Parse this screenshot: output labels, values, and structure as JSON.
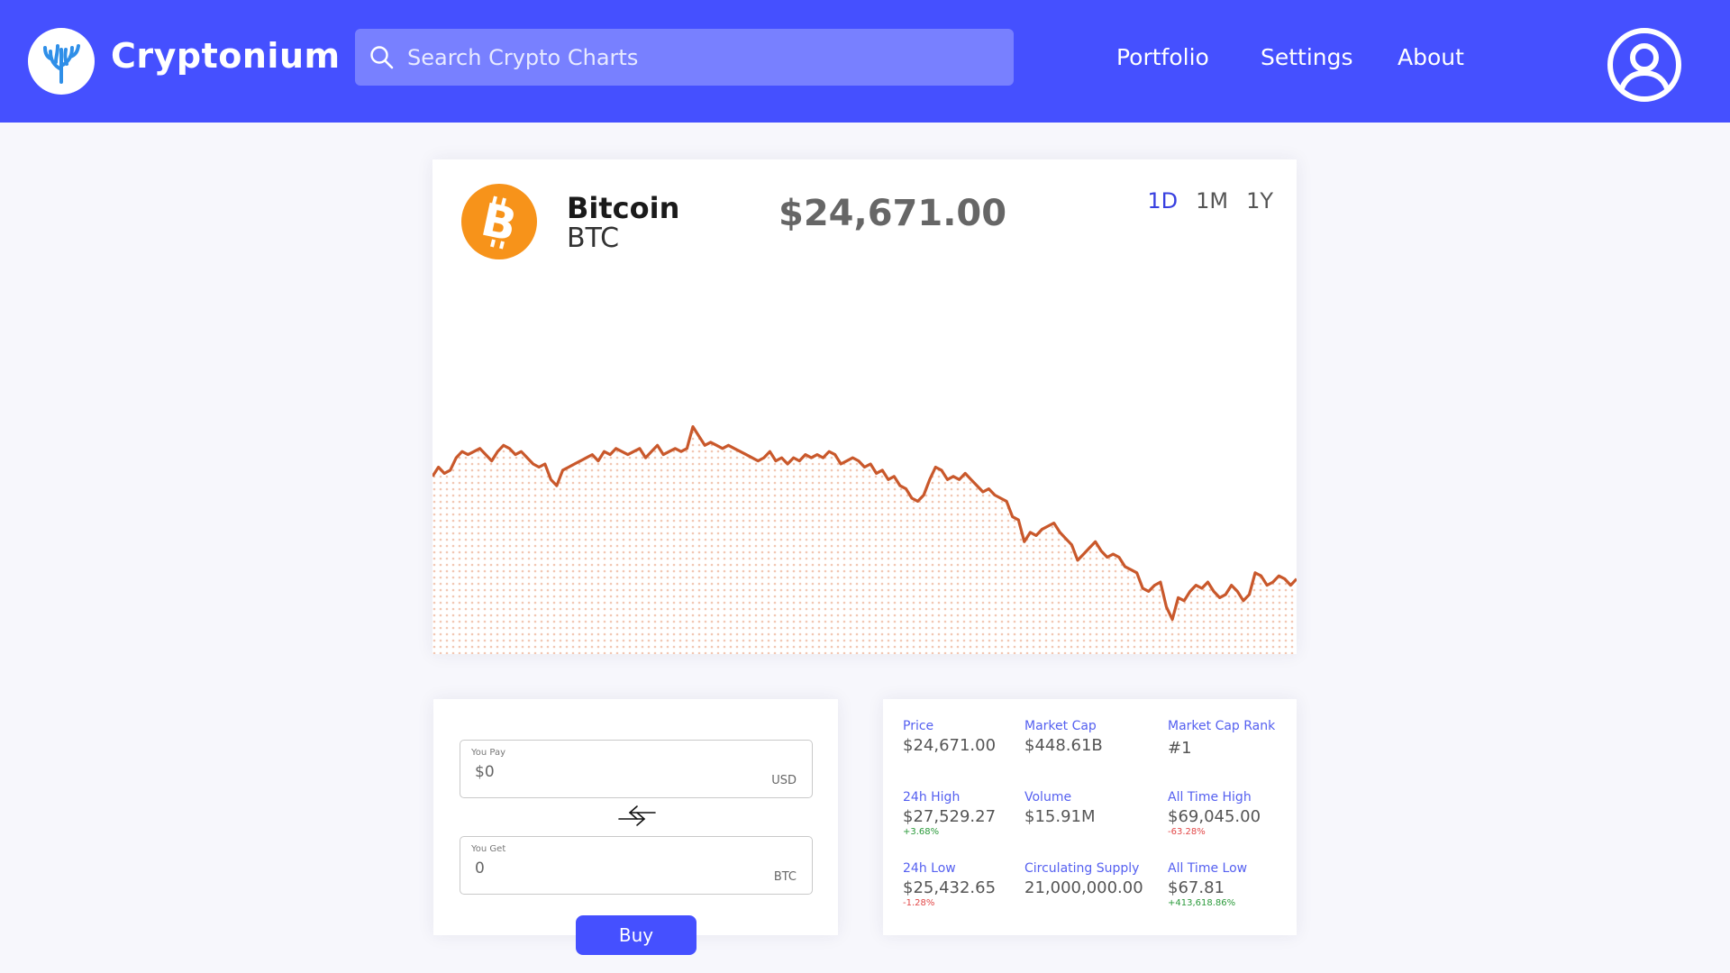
{
  "header": {
    "brand": "Cryptonium",
    "search_placeholder": "Search Crypto Charts",
    "nav": [
      "Portfolio",
      "Settings",
      "About"
    ]
  },
  "coin": {
    "name": "Bitcoin",
    "symbol": "BTC",
    "price": "$24,671.00",
    "ranges": [
      "1D",
      "1M",
      "1Y"
    ],
    "active_range": "1D"
  },
  "chart_data": {
    "type": "area",
    "title": "",
    "xlabel": "",
    "ylabel": "",
    "line_color": "#c9582b",
    "values": [
      0.56,
      0.59,
      0.57,
      0.58,
      0.62,
      0.64,
      0.63,
      0.64,
      0.65,
      0.63,
      0.61,
      0.64,
      0.66,
      0.65,
      0.63,
      0.64,
      0.62,
      0.6,
      0.59,
      0.6,
      0.55,
      0.53,
      0.58,
      0.59,
      0.6,
      0.61,
      0.62,
      0.63,
      0.61,
      0.64,
      0.63,
      0.65,
      0.64,
      0.63,
      0.64,
      0.65,
      0.62,
      0.64,
      0.66,
      0.63,
      0.64,
      0.65,
      0.64,
      0.65,
      0.72,
      0.69,
      0.66,
      0.67,
      0.66,
      0.65,
      0.66,
      0.65,
      0.64,
      0.63,
      0.62,
      0.61,
      0.62,
      0.64,
      0.61,
      0.62,
      0.6,
      0.62,
      0.61,
      0.63,
      0.62,
      0.63,
      0.62,
      0.64,
      0.63,
      0.6,
      0.61,
      0.62,
      0.61,
      0.59,
      0.6,
      0.57,
      0.58,
      0.55,
      0.56,
      0.53,
      0.52,
      0.49,
      0.48,
      0.5,
      0.55,
      0.59,
      0.58,
      0.55,
      0.56,
      0.55,
      0.57,
      0.55,
      0.53,
      0.51,
      0.52,
      0.5,
      0.49,
      0.48,
      0.43,
      0.42,
      0.35,
      0.38,
      0.37,
      0.39,
      0.4,
      0.41,
      0.38,
      0.36,
      0.34,
      0.29,
      0.31,
      0.33,
      0.35,
      0.32,
      0.3,
      0.31,
      0.3,
      0.27,
      0.26,
      0.25,
      0.2,
      0.19,
      0.21,
      0.22,
      0.14,
      0.1,
      0.17,
      0.16,
      0.19,
      0.21,
      0.2,
      0.22,
      0.19,
      0.17,
      0.18,
      0.21,
      0.19,
      0.16,
      0.18,
      0.25,
      0.24,
      0.21,
      0.22,
      0.24,
      0.23,
      0.21,
      0.23
    ]
  },
  "trade": {
    "pay_label": "You Pay",
    "pay_value": "$0",
    "pay_unit": "USD",
    "get_label": "You Get",
    "get_value": "0",
    "get_unit": "BTC",
    "buy_label": "Buy"
  },
  "stats": [
    {
      "label": "Price",
      "value": "$24,671.00",
      "change": "",
      "dir": ""
    },
    {
      "label": "Market Cap",
      "value": "$448.61B",
      "change": "",
      "dir": ""
    },
    {
      "label": "Market Cap Rank",
      "value": "#1",
      "change": "",
      "dir": ""
    },
    {
      "label": "24h High",
      "value": "$27,529.27",
      "change": "+3.68%",
      "dir": "pos"
    },
    {
      "label": "Volume",
      "value": "$15.91M",
      "change": "",
      "dir": ""
    },
    {
      "label": "All Time High",
      "value": "$69,045.00",
      "change": "-63.28%",
      "dir": "neg"
    },
    {
      "label": "24h Low",
      "value": "$25,432.65",
      "change": "-1.28%",
      "dir": "neg"
    },
    {
      "label": "Circulating Supply",
      "value": "21,000,000.00",
      "change": "",
      "dir": ""
    },
    {
      "label": "All Time Low",
      "value": "$67.81",
      "change": "+413,618.86%",
      "dir": "pos"
    }
  ],
  "colors": {
    "brand": "#4550ff",
    "accent_text": "#5560f0",
    "positive": "#2a9a3a",
    "negative": "#e24848",
    "coin": "#f7931a"
  },
  "icons": {
    "logo": "coral-icon",
    "search": "search-icon",
    "profile": "user-circle-icon",
    "coin": "bitcoin-icon",
    "swap": "swap-arrows-icon"
  }
}
